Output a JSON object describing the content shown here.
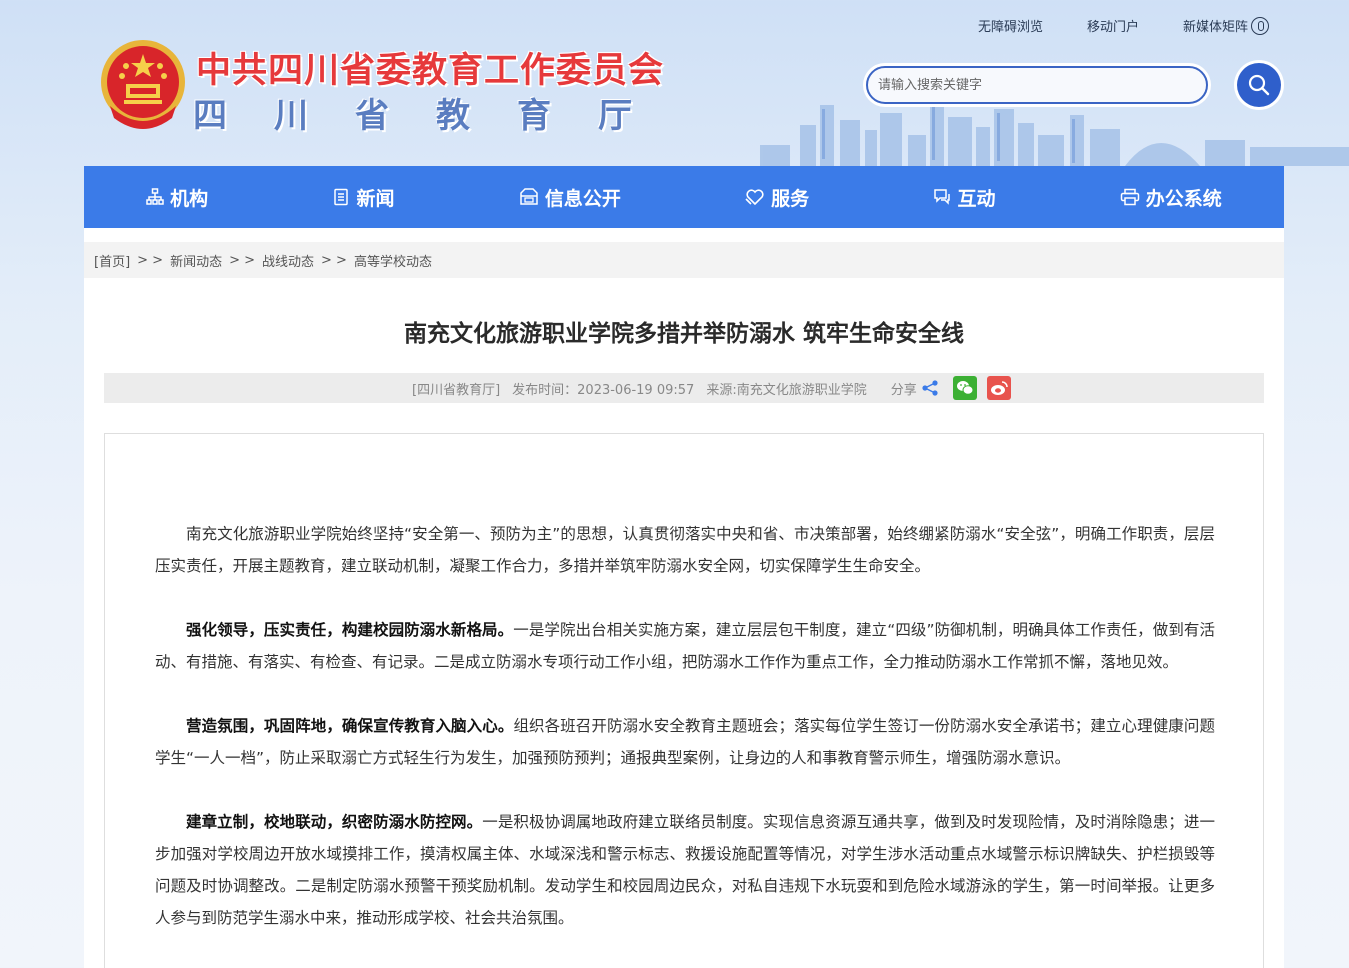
{
  "header": {
    "top_links": [
      "无障碍浏览",
      "移动门户",
      "新媒体矩阵"
    ],
    "title_main": "中共四川省委教育工作委员会",
    "title_sub": "四川省教育厅",
    "search_placeholder": "请输入搜索关键字"
  },
  "nav": {
    "items": [
      {
        "label": "机构",
        "icon": "org-icon"
      },
      {
        "label": "新闻",
        "icon": "news-icon"
      },
      {
        "label": "信息公开",
        "icon": "info-icon"
      },
      {
        "label": "服务",
        "icon": "service-icon"
      },
      {
        "label": "互动",
        "icon": "chat-icon"
      },
      {
        "label": "办公系统",
        "icon": "printer-icon"
      }
    ]
  },
  "breadcrumb": {
    "home": "[首页]",
    "sep": "> >",
    "items": [
      "新闻动态",
      "战线动态",
      "高等学校动态"
    ]
  },
  "article": {
    "title": "南充文化旅游职业学院多措并举防溺水 筑牢生命安全线",
    "meta": {
      "publisher": "[四川省教育厅]",
      "date": "发布时间：2023-06-19 09:57",
      "source": "来源:南充文化旅游职业学院",
      "share": "分享"
    },
    "paragraphs": [
      {
        "lead": "",
        "text": "南充文化旅游职业学院始终坚持“安全第一、预防为主”的思想，认真贯彻落实中央和省、市决策部署，始终绷紧防溺水“安全弦”，明确工作职责，层层压实责任，开展主题教育，建立联动机制，凝聚工作合力，多措并举筑牢防溺水安全网，切实保障学生生命安全。"
      },
      {
        "lead": "强化领导，压实责任，构建校园防溺水新格局。",
        "text": "一是学院出台相关实施方案，建立层层包干制度，建立“四级”防御机制，明确具体工作责任，做到有活动、有措施、有落实、有检查、有记录。二是成立防溺水专项行动工作小组，把防溺水工作作为重点工作，全力推动防溺水工作常抓不懈，落地见效。"
      },
      {
        "lead": "营造氛围，巩固阵地，确保宣传教育入脑入心。",
        "text": "组织各班召开防溺水安全教育主题班会；落实每位学生签订一份防溺水安全承诺书；建立心理健康问题学生“一人一档”，防止采取溺亡方式轻生行为发生，加强预防预判；通报典型案例，让身边的人和事教育警示师生，增强防溺水意识。"
      },
      {
        "lead": "建章立制，校地联动，织密防溺水防控网。",
        "text": "一是积极协调属地政府建立联络员制度。实现信息资源互通共享，做到及时发现险情，及时消除隐患；进一步加强对学校周边开放水域摸排工作，摸清权属主体、水域深浅和警示标志、救援设施配置等情况，对学生涉水活动重点水域警示标识牌缺失、护栏损毁等问题及时协调整改。二是制定防溺水预警干预奖励机制。发动学生和校园周边民众，对私自违规下水玩耍和到危险水域游泳的学生，第一时间举报。让更多人参与到防范学生溺水中来，推动形成学校、社会共治氛围。"
      }
    ]
  },
  "colors": {
    "nav_bg": "#3b7be8",
    "title_red": "#e6393b",
    "title_blue": "#5a7dc0",
    "search_blue": "#2f5fcb"
  }
}
